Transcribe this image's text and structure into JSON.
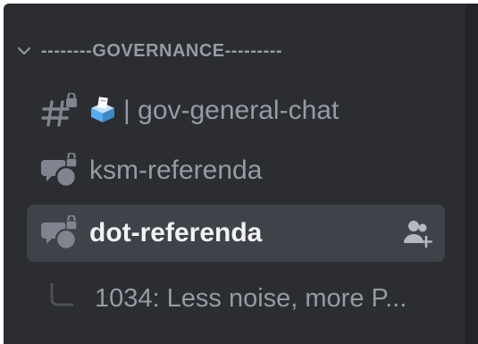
{
  "category": {
    "name": "--------GOVERNANCE---------",
    "chevron_icon": "chevron-down-icon"
  },
  "channels": [
    {
      "type": "text-locked",
      "icon": "hash-lock-icon",
      "emoji": "ballot-box-icon",
      "separator": "|",
      "name": "gov-general-chat"
    },
    {
      "type": "forum-locked",
      "icon": "forum-lock-icon",
      "name": "ksm-referenda"
    },
    {
      "type": "forum-locked",
      "icon": "forum-lock-icon",
      "name": "dot-referenda",
      "selected": true,
      "action_icon": "add-member-icon"
    }
  ],
  "thread": {
    "icon": "thread-spine-icon",
    "name": "1034: Less noise, more P..."
  },
  "colors": {
    "sidebar_bg": "#2b2d31",
    "selected_bg": "#404249",
    "muted_text": "#949ba4",
    "active_text": "#f2f3f5"
  }
}
